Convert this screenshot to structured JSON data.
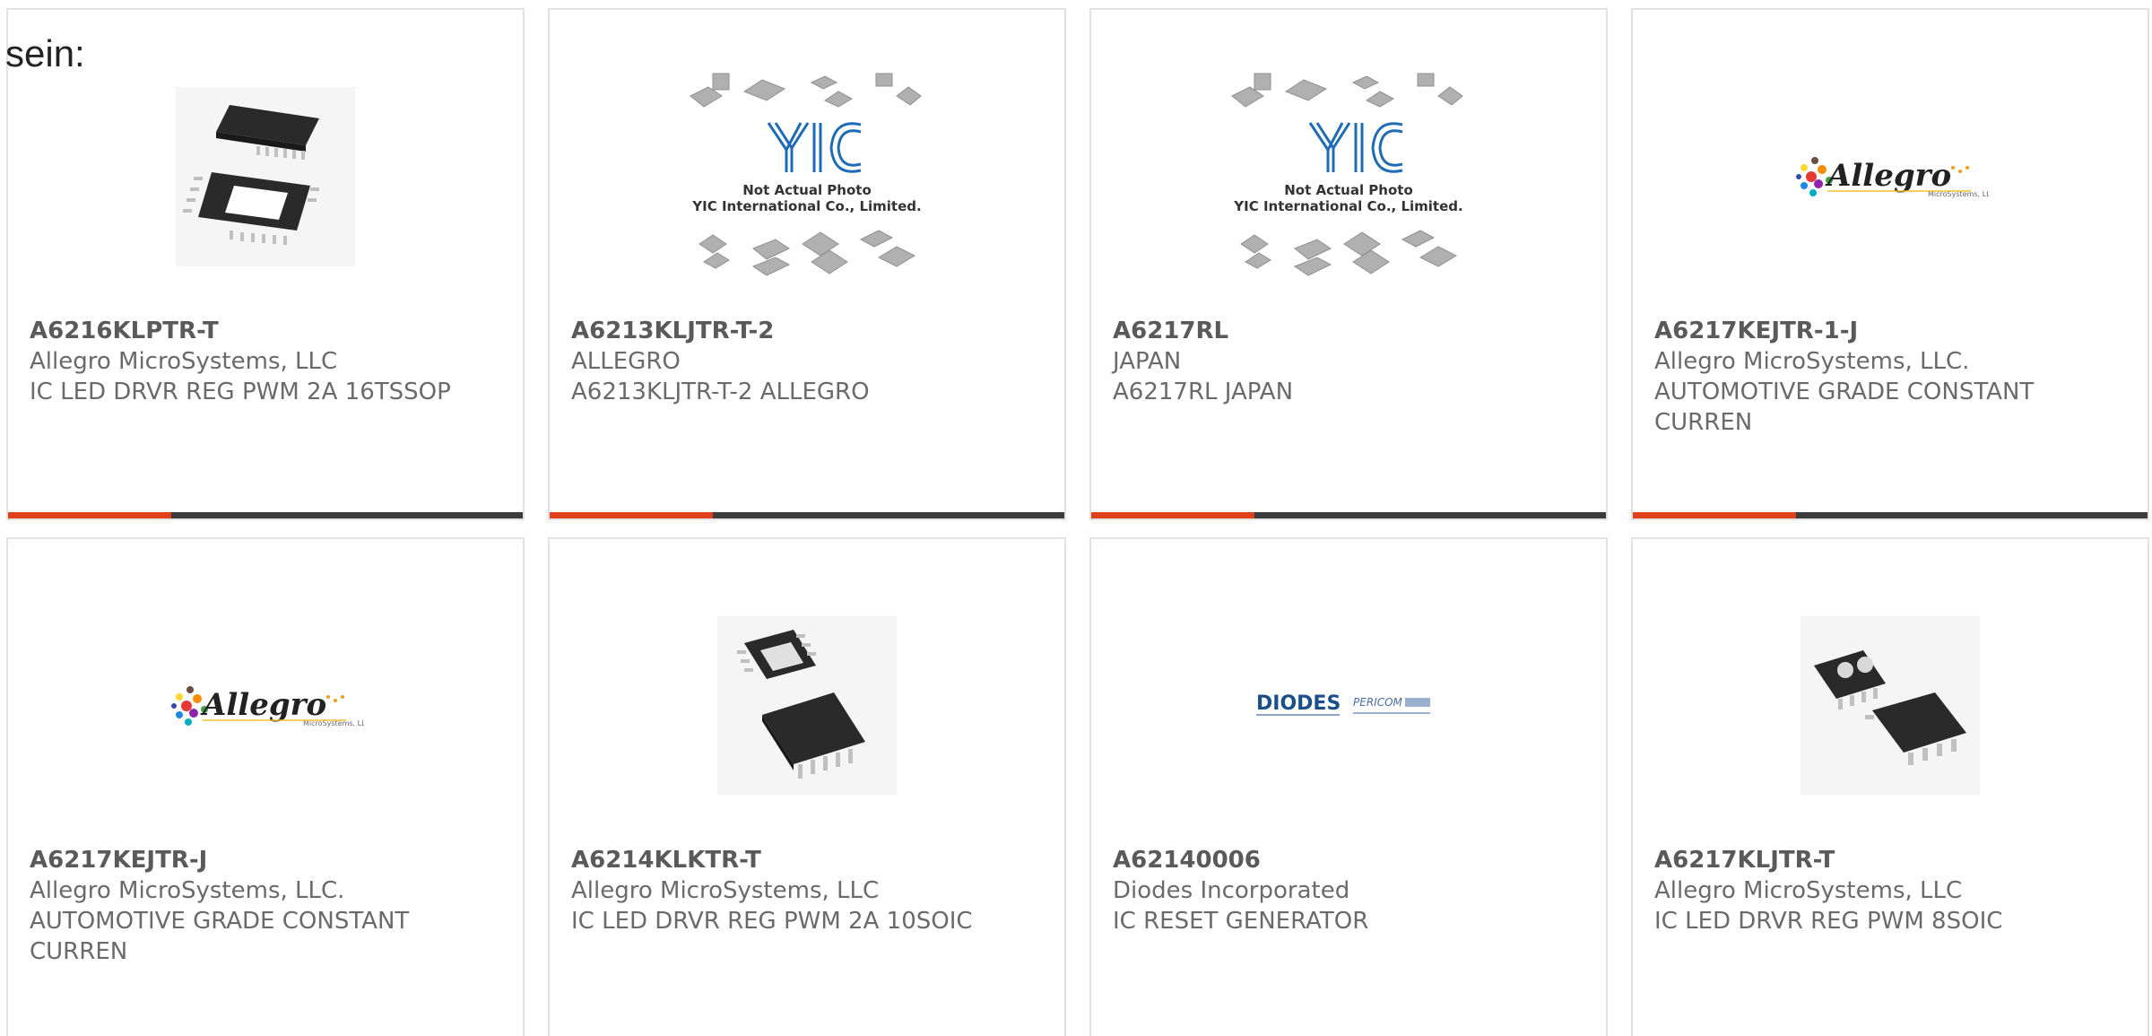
{
  "intro_text": "sein:",
  "colors": {
    "accent": "#e0401a",
    "bar": "#3c3c3c",
    "card_border": "#e2e2e2",
    "text": "#6a6a6a"
  },
  "products": [
    {
      "part_number": "A6216KLPTR-T",
      "manufacturer": "Allegro MicroSystems, LLC",
      "description": "IC LED DRVR REG PWM 2A 16TSSOP",
      "image": "tssop16-chip-photo"
    },
    {
      "part_number": "A6213KLJTR-T-2",
      "manufacturer": "ALLEGRO",
      "description": "A6213KLJTR-T-2 ALLEGRO",
      "image": "yic-placeholder",
      "image_caption_1": "Not Actual Photo",
      "image_caption_2": "YIC International Co., Limited."
    },
    {
      "part_number": "A6217RL",
      "manufacturer": "JAPAN",
      "description": "A6217RL JAPAN",
      "image": "yic-placeholder",
      "image_caption_1": "Not Actual Photo",
      "image_caption_2": "YIC International Co., Limited."
    },
    {
      "part_number": "A6217KEJTR-1-J",
      "manufacturer": "Allegro MicroSystems, LLC.",
      "description": "AUTOMOTIVE GRADE CONSTANT CURREN",
      "image": "allegro-logo",
      "logo_text": "Allegro",
      "logo_subtext": "MicroSystems, LLC"
    },
    {
      "part_number": "A6217KEJTR-J",
      "manufacturer": "Allegro MicroSystems, LLC.",
      "description": "AUTOMOTIVE GRADE CONSTANT CURREN",
      "image": "allegro-logo",
      "logo_text": "Allegro",
      "logo_subtext": "MicroSystems, LLC"
    },
    {
      "part_number": "A6214KLKTR-T",
      "manufacturer": "Allegro MicroSystems, LLC",
      "description": "IC LED DRVR REG PWM 2A 10SOIC",
      "image": "soic10-chip-photo"
    },
    {
      "part_number": "A62140006",
      "manufacturer": "Diodes Incorporated",
      "description": "IC RESET GENERATOR",
      "image": "diodes-pericom-logo",
      "logo_text": "DIODES",
      "logo_subtext": "PERICOM"
    },
    {
      "part_number": "A6217KLJTR-T",
      "manufacturer": "Allegro MicroSystems, LLC",
      "description": "IC LED DRVR REG PWM 8SOIC",
      "image": "soic8-chip-photo"
    }
  ]
}
